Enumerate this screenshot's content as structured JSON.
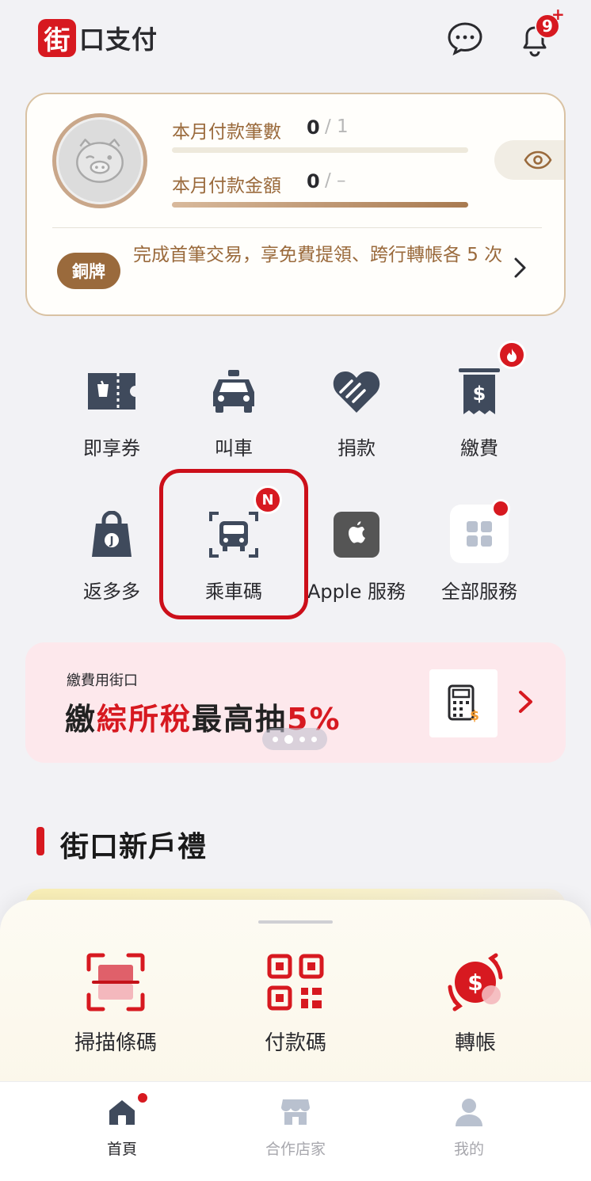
{
  "app": {
    "logo_mark": "街",
    "logo_text": "口支付"
  },
  "header": {
    "notifications_count": "9",
    "notifications_plus": "+"
  },
  "member_card": {
    "payments_count": {
      "label": "本月付款筆數",
      "value": "0",
      "limit": "/ 1"
    },
    "payments_amount": {
      "label": "本月付款金額",
      "value": "0",
      "limit": "/ –"
    },
    "tier_badge": "銅牌",
    "tier_message": "完成首筆交易，享免費提領、跨行轉帳各 5 次"
  },
  "services": [
    {
      "label": "即享券",
      "icon": "coupon-icon"
    },
    {
      "label": "叫車",
      "icon": "taxi-icon"
    },
    {
      "label": "捐款",
      "icon": "donate-heart-icon"
    },
    {
      "label": "繳費",
      "icon": "bill-icon",
      "badge": "hot-flame"
    },
    {
      "label": "返多多",
      "icon": "shopping-bag-icon"
    },
    {
      "label": "乘車碼",
      "icon": "ride-code-icon",
      "badge": "N"
    },
    {
      "label": "Apple 服務",
      "icon": "apple-icon"
    },
    {
      "label": "全部服務",
      "icon": "grid-icon",
      "badge": "dot"
    }
  ],
  "banner": {
    "subtitle": "繳費用街口",
    "title_1": "繳",
    "title_2": "綜所稅",
    "title_3": "最高抽",
    "title_4": "5%",
    "slide_count": 4,
    "active_slide": 2
  },
  "section": {
    "title": "街口新戶禮"
  },
  "quick_actions": [
    {
      "label": "掃描條碼",
      "icon": "scan-barcode-icon"
    },
    {
      "label": "付款碼",
      "icon": "qr-code-icon"
    },
    {
      "label": "轉帳",
      "icon": "transfer-icon"
    }
  ],
  "tabs": [
    {
      "label": "首頁",
      "icon": "home-icon",
      "active": true
    },
    {
      "label": "合作店家",
      "icon": "store-icon",
      "active": false
    },
    {
      "label": "我的",
      "icon": "profile-icon",
      "active": false
    }
  ],
  "colors": {
    "brand_red": "#d71920",
    "copper": "#9a6a3c",
    "highlight": "#cc0f1a"
  }
}
